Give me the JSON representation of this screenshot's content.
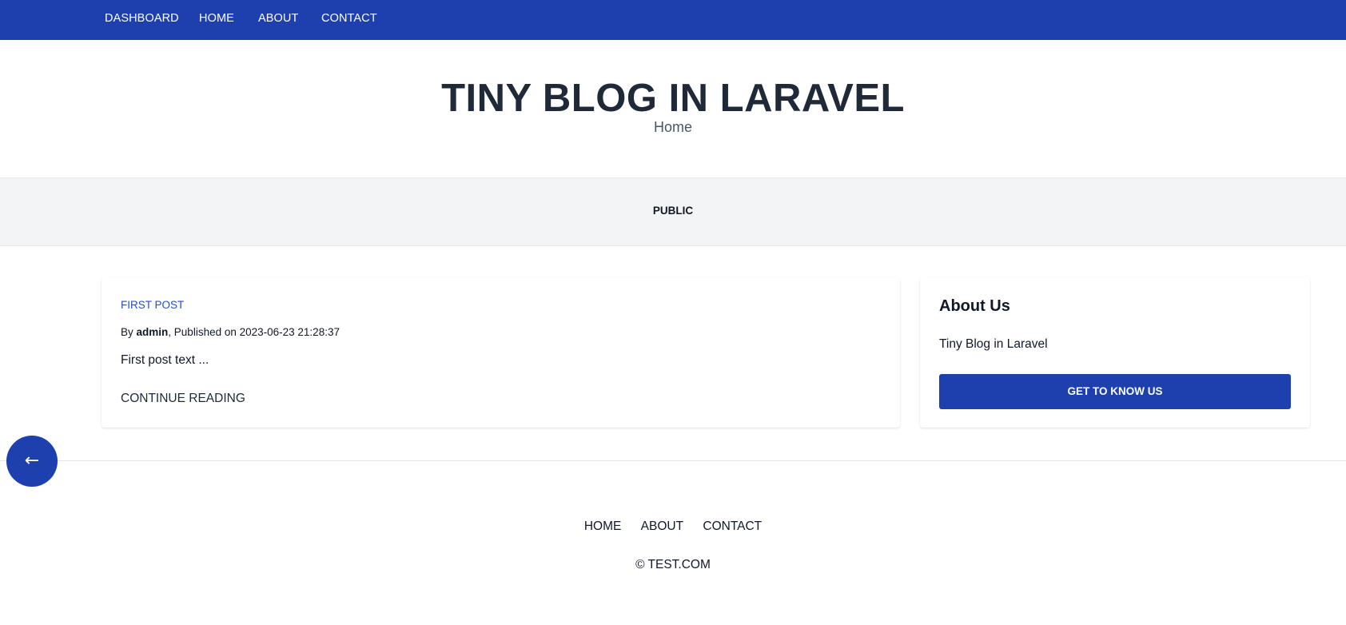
{
  "topnav": {
    "items": [
      "DASHBOARD",
      "HOME",
      "ABOUT",
      "CONTACT"
    ]
  },
  "header": {
    "title": "TINY BLOG IN LARAVEL",
    "subtitle": "Home"
  },
  "category_bar": {
    "label": "PUBLIC"
  },
  "post": {
    "category": "FIRST POST",
    "by_label": "By",
    "author": "admin",
    "published_label": ", Published on 2023-06-23 21:28:37",
    "excerpt": "First post text ...",
    "continue_label": "CONTINUE READING"
  },
  "about": {
    "heading": "About Us",
    "text": "Tiny Blog in Laravel",
    "button_label": "GET TO KNOW US"
  },
  "back_button": {
    "glyph": "←",
    "icon": "arrow-left-icon"
  },
  "footer": {
    "items": [
      "HOME",
      "ABOUT",
      "CONTACT"
    ],
    "copyright": "© TEST.COM"
  },
  "colors": {
    "primary": "#1e40af",
    "link": "#1d4ed8",
    "category_bg": "#f3f4f6"
  }
}
